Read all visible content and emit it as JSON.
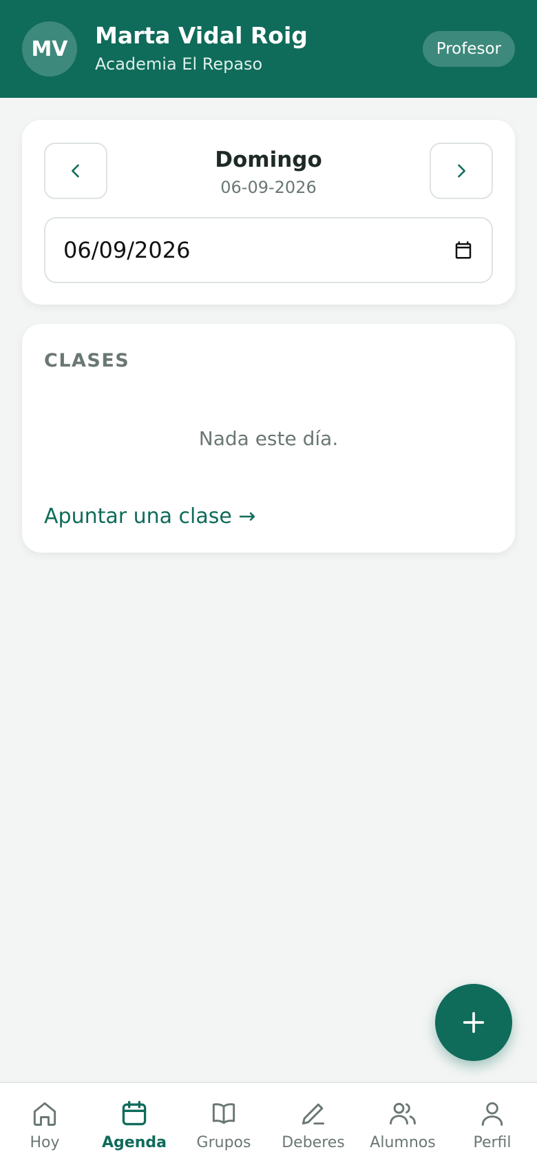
{
  "header": {
    "avatar_initials": "MV",
    "user_name": "Marta Vidal Roig",
    "organization": "Academia El Repaso",
    "role": "Profesor"
  },
  "date_picker": {
    "prev_icon": "chevron-left-icon",
    "next_icon": "chevron-right-icon",
    "day_name": "Domingo",
    "date_text": "06-09-2026",
    "input_value": "06/09/2026",
    "calendar_icon": "calendar-icon"
  },
  "classes": {
    "title": "CLASES",
    "empty_message": "Nada este día.",
    "add_link": "Apuntar una clase →"
  },
  "fab": {
    "icon": "plus-icon"
  },
  "bottom_nav": {
    "items": [
      {
        "label": "Hoy",
        "icon": "home-icon",
        "active": false
      },
      {
        "label": "Agenda",
        "icon": "calendar-icon",
        "active": true
      },
      {
        "label": "Grupos",
        "icon": "book-icon",
        "active": false
      },
      {
        "label": "Deberes",
        "icon": "pencil-icon",
        "active": false
      },
      {
        "label": "Alumnos",
        "icon": "users-icon",
        "active": false
      },
      {
        "label": "Perfil",
        "icon": "user-icon",
        "active": false
      }
    ]
  },
  "colors": {
    "brand": "#0f6b5a",
    "background": "#f3f5f4",
    "muted_text": "#6a7772"
  }
}
